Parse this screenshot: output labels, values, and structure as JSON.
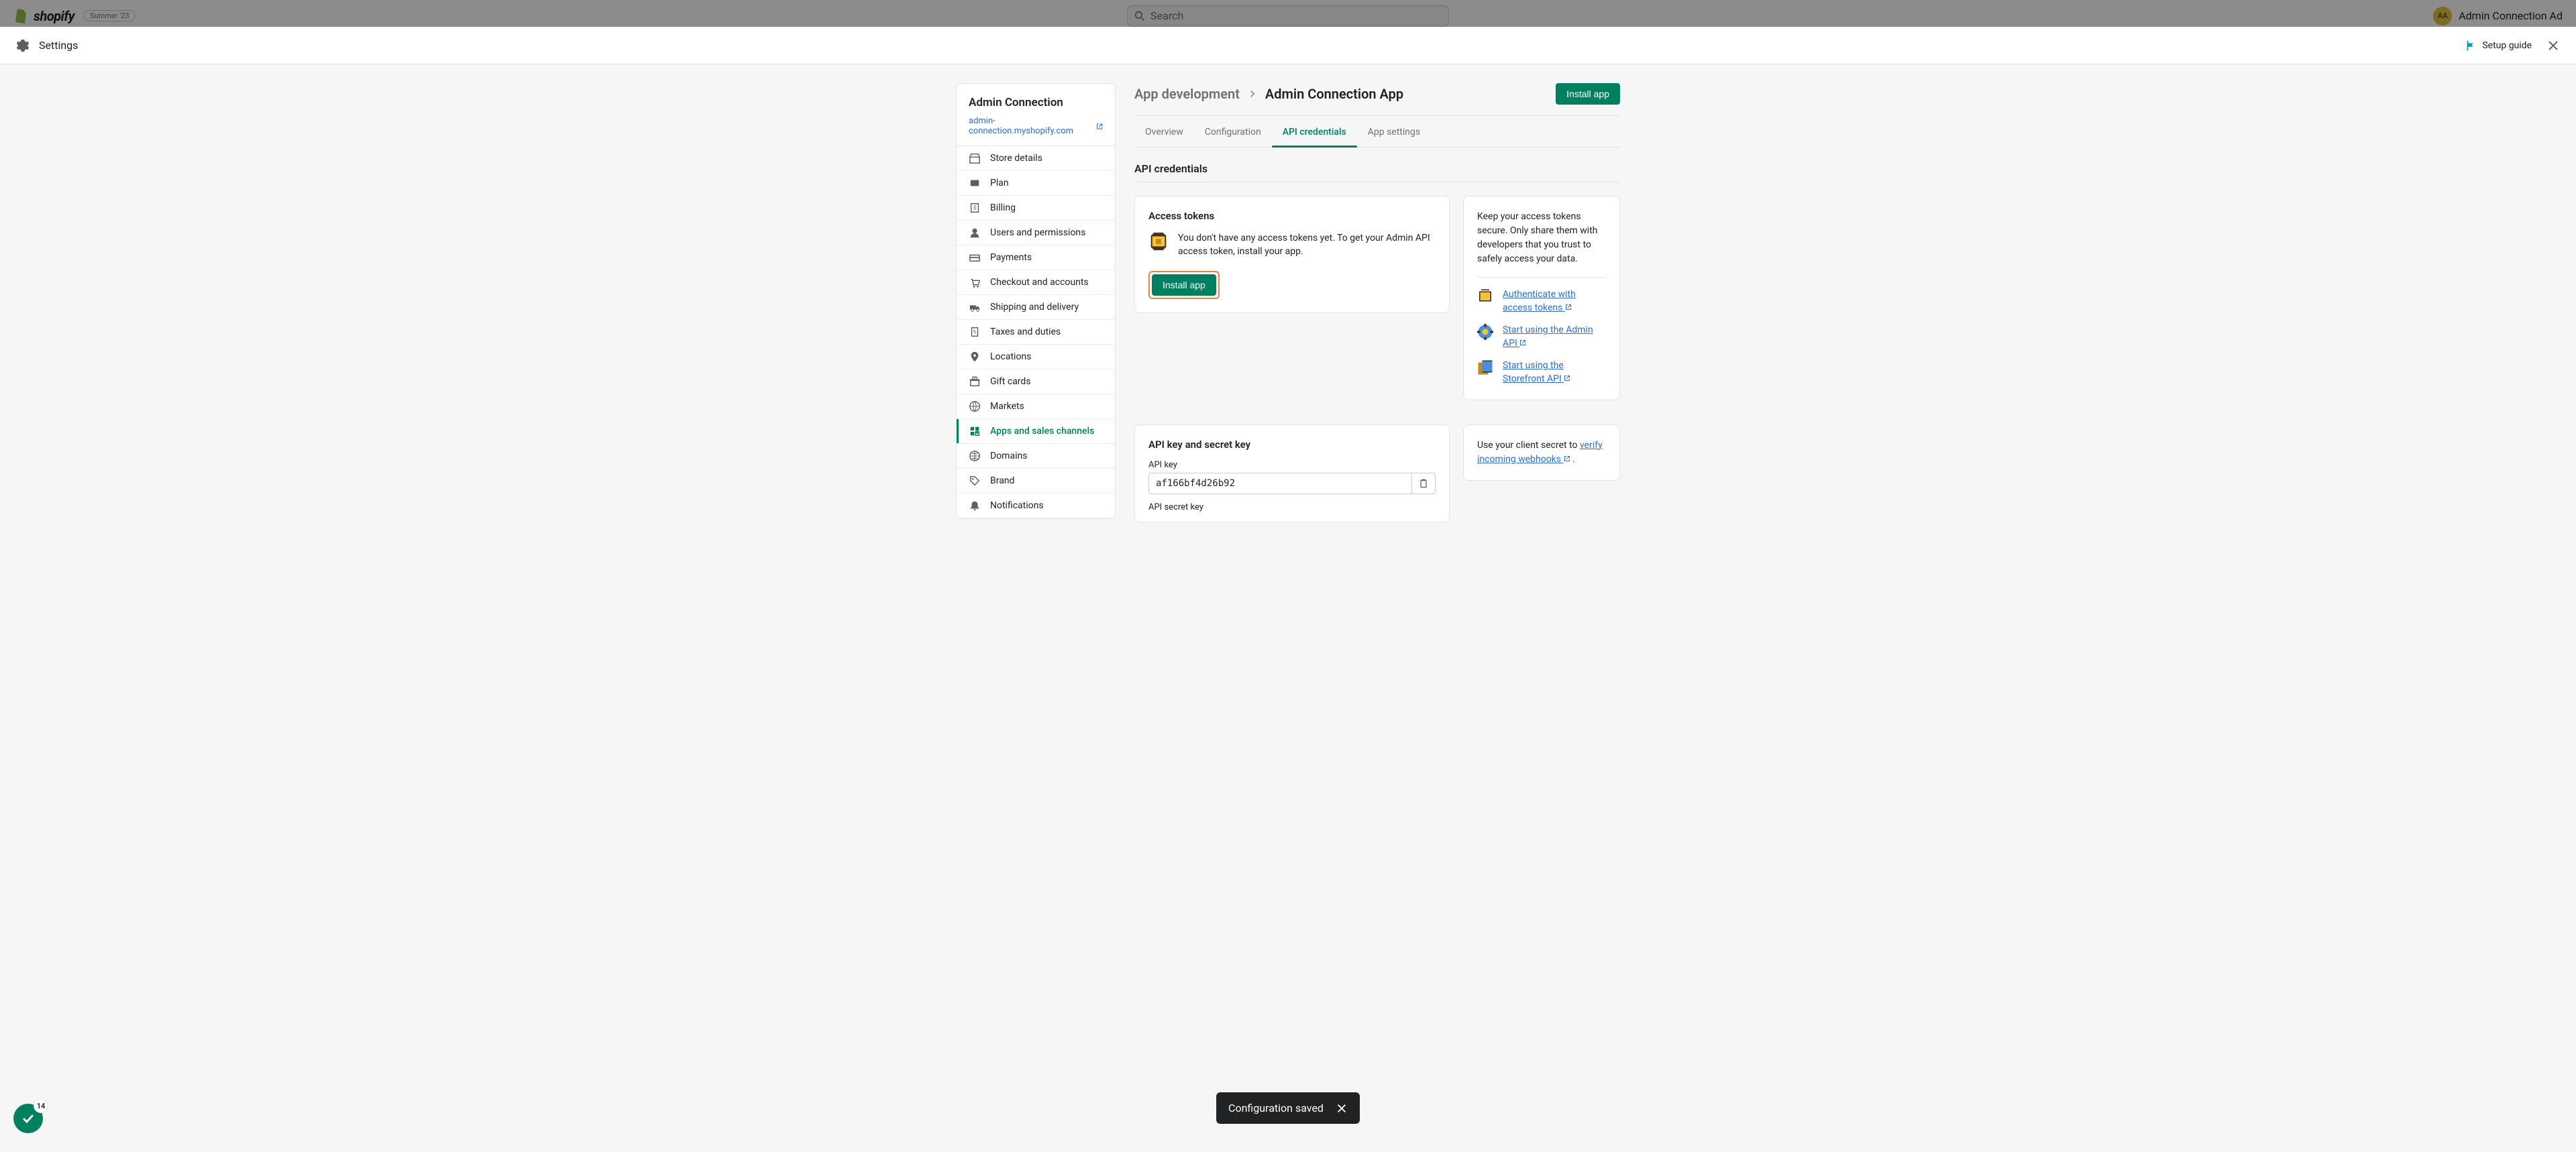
{
  "backdrop": {
    "logo_text": "shopify",
    "badge": "Summer '23",
    "search_placeholder": "Search",
    "user_initials": "AA",
    "user_name": "Admin Connection Ad"
  },
  "modal": {
    "title": "Settings",
    "setup_guide": "Setup guide"
  },
  "sidebar": {
    "store_name": "Admin Connection",
    "store_url": "admin-connection.myshopify.com",
    "items": [
      {
        "label": "Store details",
        "icon": "store"
      },
      {
        "label": "Plan",
        "icon": "plan"
      },
      {
        "label": "Billing",
        "icon": "billing"
      },
      {
        "label": "Users and permissions",
        "icon": "users"
      },
      {
        "label": "Payments",
        "icon": "payments"
      },
      {
        "label": "Checkout and accounts",
        "icon": "checkout"
      },
      {
        "label": "Shipping and delivery",
        "icon": "shipping"
      },
      {
        "label": "Taxes and duties",
        "icon": "taxes"
      },
      {
        "label": "Locations",
        "icon": "locations"
      },
      {
        "label": "Gift cards",
        "icon": "gift"
      },
      {
        "label": "Markets",
        "icon": "markets"
      },
      {
        "label": "Apps and sales channels",
        "icon": "apps",
        "active": true
      },
      {
        "label": "Domains",
        "icon": "domains"
      },
      {
        "label": "Brand",
        "icon": "brand"
      },
      {
        "label": "Notifications",
        "icon": "notifications"
      }
    ]
  },
  "breadcrumb": {
    "parent": "App development",
    "current": "Admin Connection App",
    "install_btn": "Install app"
  },
  "tabs": [
    {
      "label": "Overview"
    },
    {
      "label": "Configuration"
    },
    {
      "label": "API credentials",
      "active": true
    },
    {
      "label": "App settings"
    }
  ],
  "section": {
    "heading": "API credentials"
  },
  "access_tokens": {
    "title": "Access tokens",
    "message": "You don't have any access tokens yet. To get your Admin API access token, install your app.",
    "install_btn": "Install app"
  },
  "side_info": {
    "text": "Keep your access tokens secure. Only share them with developers that you trust to safely access your data.",
    "links": [
      {
        "label": "Authenticate with access tokens"
      },
      {
        "label": "Start using the Admin API"
      },
      {
        "label": "Start using the Storefront API"
      }
    ]
  },
  "api_keys": {
    "title": "API key and secret key",
    "key_label": "API key",
    "key_value": "af166bf4d26b92",
    "secret_label": "API secret key"
  },
  "side_info2": {
    "prefix": "Use your client secret to ",
    "link": "verify incoming webhooks",
    "suffix": " ."
  },
  "toast": {
    "message": "Configuration saved"
  },
  "fab": {
    "badge": "14"
  }
}
